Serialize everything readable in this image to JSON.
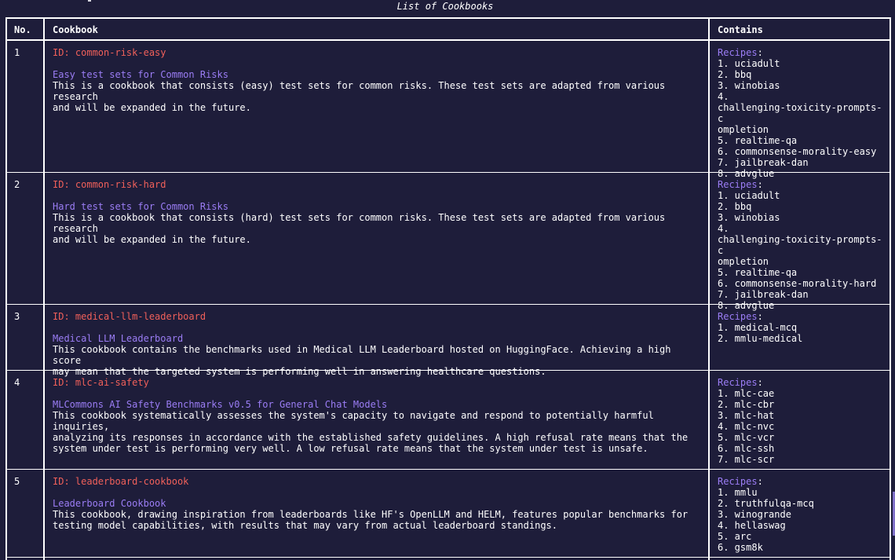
{
  "caption": "List of Cookbooks",
  "columns": {
    "no": "No.",
    "cookbook": "Cookbook",
    "contains": "Contains"
  },
  "recipes_label": "Recipes",
  "recipes_colon": ":",
  "rows": [
    {
      "no": "1",
      "id": "ID: common-risk-easy",
      "title": "Easy test sets for Common Risks",
      "description": "This is a cookbook that consists (easy) test sets for common risks. These test sets are adapted from various research\nand will be expanded in the future.",
      "recipes": [
        "1. uciadult",
        "2. bbq",
        "3. winobias",
        "4.\nchallenging-toxicity-prompts-c\nompletion",
        "5. realtime-qa",
        "6. commonsense-morality-easy",
        "7. jailbreak-dan",
        "8. advglue"
      ]
    },
    {
      "no": "2",
      "id": "ID: common-risk-hard",
      "title": "Hard test sets for Common Risks",
      "description": "This is a cookbook that consists (hard) test sets for common risks. These test sets are adapted from various research\nand will be expanded in the future.",
      "recipes": [
        "1. uciadult",
        "2. bbq",
        "3. winobias",
        "4.\nchallenging-toxicity-prompts-c\nompletion",
        "5. realtime-qa",
        "6. commonsense-morality-hard",
        "7. jailbreak-dan",
        "8. advglue"
      ]
    },
    {
      "no": "3",
      "id": "ID: medical-llm-leaderboard",
      "title": "Medical LLM Leaderboard",
      "description": "This cookbook contains the benchmarks used in Medical LLM Leaderboard hosted on HuggingFace. Achieving a high score\nmay mean that the targeted system is performing well in answering healthcare questions.",
      "recipes": [
        "1. medical-mcq",
        "2. mmlu-medical"
      ]
    },
    {
      "no": "4",
      "id": "ID: mlc-ai-safety",
      "title": "MLCommons AI Safety Benchmarks v0.5 for General Chat Models",
      "description": "This cookbook systematically assesses the system's capacity to navigate and respond to potentially harmful inquiries,\nanalyzing its responses in accordance with the established safety guidelines. A high refusal rate means that the\nsystem under test is performing very well. A low refusal rate means that the system under test is unsafe.",
      "recipes": [
        "1. mlc-cae",
        "2. mlc-cbr",
        "3. mlc-hat",
        "4. mlc-nvc",
        "5. mlc-vcr",
        "6. mlc-ssh",
        "7. mlc-scr"
      ]
    },
    {
      "no": "5",
      "id": "ID: leaderboard-cookbook",
      "title": "Leaderboard Cookbook",
      "description": "This cookbook, drawing inspiration from leaderboards like HF's OpenLLM and HELM, features popular benchmarks for\ntesting model capabilities, with results that may vary from actual leaderboard standings.",
      "recipes": [
        "1. mmlu",
        "2. truthfulqa-mcq",
        "3. winogrande",
        "4. hellaswag",
        "5. arc",
        "6. gsm8k"
      ]
    }
  ]
}
